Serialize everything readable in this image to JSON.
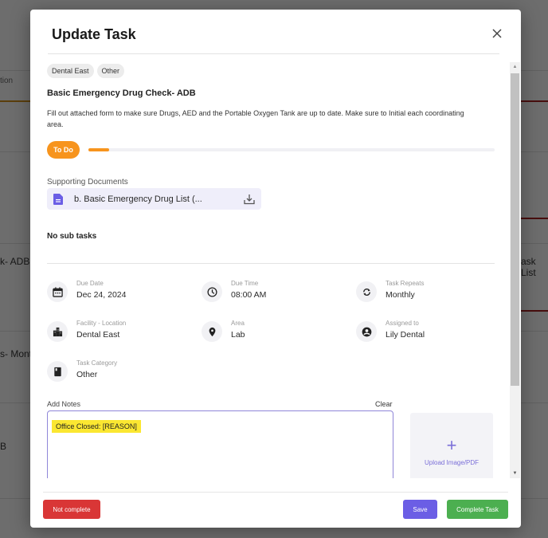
{
  "background": {
    "texts": [
      "tion",
      "k- ADB",
      "s- Month",
      "B",
      "ask List"
    ]
  },
  "modal": {
    "title": "Update Task",
    "tags": [
      "Dental East",
      "Other"
    ],
    "task_title": "Basic Emergency Drug Check- ADB",
    "description": "Fill out attached form to make sure Drugs, AED and the Portable Oxygen Tank are up to date. Make sure to Initial each coordinating area.",
    "status": {
      "label": "To Do",
      "progress_percent": 5,
      "color": "#f7941d"
    },
    "supporting_documents": {
      "label": "Supporting Documents",
      "files": [
        {
          "name": "b. Basic Emergency Drug List (...",
          "icon": "document-icon"
        }
      ]
    },
    "subtasks_label": "No sub tasks",
    "details": [
      {
        "icon": "calendar-icon",
        "label": "Due Date",
        "value": "Dec 24, 2024"
      },
      {
        "icon": "clock-icon",
        "label": "Due Time",
        "value": "08:00 AM"
      },
      {
        "icon": "repeat-icon",
        "label": "Task Repeats",
        "value": "Monthly"
      },
      {
        "icon": "building-icon",
        "label": "Facility - Location",
        "value": "Dental East"
      },
      {
        "icon": "location-pin-icon",
        "label": "Area",
        "value": "Lab"
      },
      {
        "icon": "user-circle-icon",
        "label": "Assigned to",
        "value": "Lily Dental"
      },
      {
        "icon": "book-icon",
        "label": "Task Category",
        "value": "Other"
      }
    ],
    "notes": {
      "label": "Add Notes",
      "clear_label": "Clear",
      "value": "Office Closed: [REASON]"
    },
    "upload": {
      "plus": "+",
      "label": "Upload Image/PDF"
    },
    "buttons": {
      "not_complete": "Not complete",
      "save": "Save",
      "complete": "Complete Task"
    }
  }
}
